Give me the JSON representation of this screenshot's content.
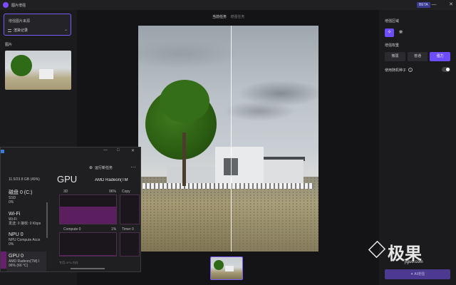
{
  "window": {
    "title": "图片增强",
    "beta_badge": "BETA",
    "controls": [
      "—",
      "□",
      "✕"
    ]
  },
  "left_panel": {
    "source_section_title": "增强图片来源",
    "source_selected": "渲染记录",
    "images_label": "图片"
  },
  "center": {
    "tabs": [
      {
        "label": "当前任务",
        "active": true
      },
      {
        "label": "增强任务",
        "active": false
      }
    ]
  },
  "right_panel": {
    "region_label": "增强区域",
    "region_buttons": [
      {
        "icon": "person-sparkle-icon",
        "active": true
      },
      {
        "icon": "landscape-icon",
        "active": false
      }
    ],
    "strength_label": "增强权重",
    "strength_options": [
      {
        "label": "微弱",
        "active": false
      },
      {
        "label": "普通",
        "active": false
      },
      {
        "label": "强力",
        "active": true
      }
    ],
    "seed_label": "使用随机种子",
    "seed_enabled": true,
    "ai_button_label": "AI增强"
  },
  "watermark": {
    "text_cn": "极果",
    "text_en": "jiguo.com"
  },
  "task_manager": {
    "run_new_task": "运行新任务",
    "sidebar": [
      {
        "main": "",
        "sub": "11.5/23.8 GB (49%)"
      },
      {
        "main": "磁盘 0 (C:)",
        "sub": "SSD",
        "sub2": "0%"
      },
      {
        "main": "Wi-Fi",
        "sub": "Wi-Fi",
        "sub2": "发送: 0 接收: 0 Kbps"
      },
      {
        "main": "NPU 0",
        "sub": "NPU Compute Acce",
        "sub2": "0%"
      },
      {
        "main": "GPU 0",
        "sub": "AMD Radeon(TM) I",
        "sub2": "96% (66 °C)"
      }
    ],
    "gpu_title": "GPU",
    "gpu_model": "AMD Radeon(TM",
    "graphs": [
      {
        "label": "3D",
        "value_label": "96%",
        "level": 0.6
      },
      {
        "label": "Copy",
        "value_label": "",
        "level": 0.0
      },
      {
        "label": "Compute 0",
        "value_label": "1%",
        "level": 0.02
      },
      {
        "label": "Timer 0",
        "value_label": "",
        "level": 0.0
      }
    ],
    "status_text": "专用 GPU 内存"
  },
  "colors": {
    "accent": "#6e4dff",
    "gpu_graph": "#5b1e5e"
  }
}
